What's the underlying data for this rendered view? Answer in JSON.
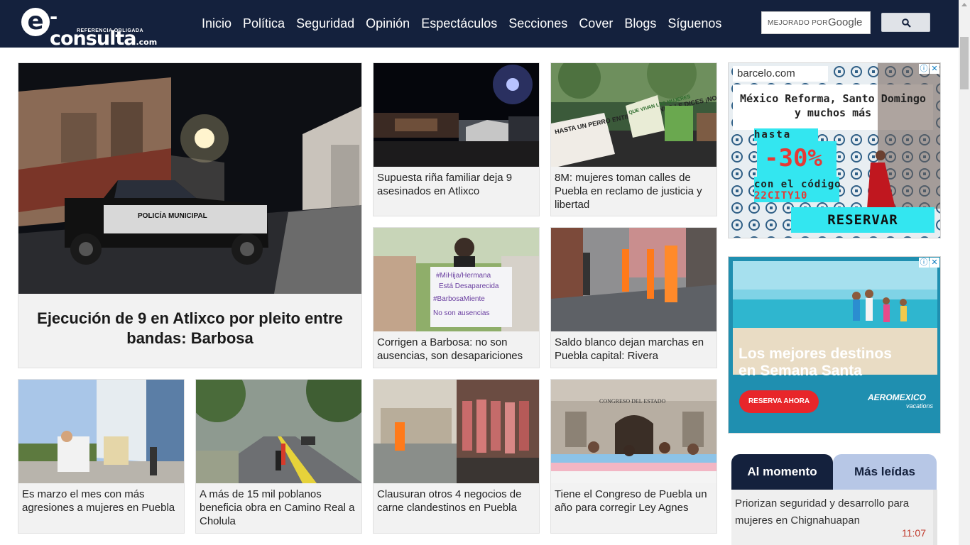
{
  "header": {
    "logo_letter": "e",
    "logo_name": "-consulta",
    "logo_com": ".com",
    "logo_tagline": "REFERENCIA OBLIGADA",
    "nav": [
      "Inicio",
      "Política",
      "Seguridad",
      "Opinión",
      "Espectáculos",
      "Secciones",
      "Cover",
      "Blogs",
      "Síguenos"
    ],
    "search_placeholder": "MEJORADO POR",
    "search_brand": "Google"
  },
  "lead": {
    "title": "Ejecución de 9 en Atlixco por pleito entre bandas: Barbosa",
    "image_text": "POLICÍA MUNICIPAL"
  },
  "stories": [
    {
      "caption": "Supuesta riña familiar deja 9 asesinados en Atlixco"
    },
    {
      "caption": "8M: mujeres toman calles de Puebla en reclamo de justicia y libertad",
      "sign1": "HASTA UN PERRO ENTIENDE CUANDO LE DICES ¡NO!",
      "sign2": "QUE VIVAN LAS MUJERES"
    },
    {
      "caption": "Corrigen a Barbosa: no son ausencias, son desapariciones",
      "sign": [
        "#MiHija/Hermana",
        "Está Desaparecida",
        "#BarbosaMiente",
        "No son ausencias"
      ]
    },
    {
      "caption": "Saldo blanco dejan marchas en Puebla capital: Rivera"
    },
    {
      "caption": "Es marzo el mes con más agresiones a mujeres en Puebla"
    },
    {
      "caption": "A más de 15 mil poblanos beneficia obra en Camino Real a Cholula"
    },
    {
      "caption": "Clausuran otros 4 negocios de carne clandestinos en Puebla"
    },
    {
      "caption": "Tiene el Congreso de Puebla un año para corregir Ley Agnes",
      "building_text": "CONGRESO DEL ESTADO"
    }
  ],
  "ads": {
    "barcelo": {
      "brand": "barcelo.com",
      "headline1": "México Reforma, Santo Domingo",
      "headline2": "y muchos más",
      "hasta": "hasta",
      "discount": "-30%",
      "code_label": "con el código",
      "code": "22CITY10",
      "cta": "RESERVAR"
    },
    "aeromexico": {
      "headline1": "Los mejores destinos",
      "headline2": "en Semana Santa",
      "cta": "RESERVA AHORA",
      "brand": "AEROMEXICO",
      "brand_sub": "vacations"
    }
  },
  "tabs": {
    "active": "Al momento",
    "inactive": "Más leídas",
    "item_text": "Priorizan seguridad y desarrollo para mujeres en Chignahuapan",
    "item_time": "11:07"
  },
  "colors": {
    "header_bg": "#14213d",
    "tab_inactive_bg": "#b7c7e6",
    "ad_cyan": "#33e6f0",
    "time_red": "#c0392b"
  }
}
